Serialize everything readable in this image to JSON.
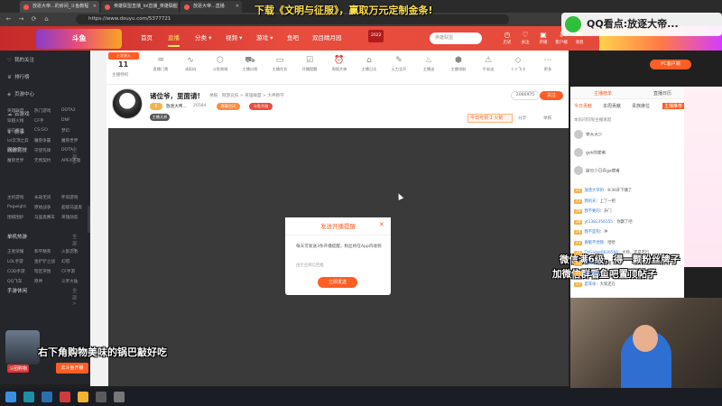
{
  "browser": {
    "tabs": [
      {
        "label": "放逐大帝...的房间_斗鱼教程"
      },
      {
        "label": "英雄联盟直播_lol直播_英雄联盟"
      },
      {
        "label": "放逐大帝...直播"
      }
    ],
    "url": "https://www.douyu.com/5377721"
  },
  "overlay": {
    "top_caption": "下载《文明与征服》，赢取万元定制金条!",
    "qq_caption": "QQ看点:放逐大帝...",
    "fans_line1": "微信满6级，得一颗粉丝牌子",
    "fans_line2": "加微信群看鱼吧置顶帖子",
    "bottom_caption": "右下角购物美味的锅巴敲好吃"
  },
  "header": {
    "logo": "斗鱼",
    "nav": [
      "首页",
      "直播",
      "分类 ▾",
      "视频 ▾",
      "游戏 ▾",
      "鱼吧",
      "双目睛月园"
    ],
    "badge_2022": "2022",
    "search_placeholder": "英雄联盟",
    "icons": [
      "历史",
      "关注",
      "开播",
      "客户端",
      "消息",
      "领任务",
      "我的"
    ]
  },
  "sidebar": {
    "items": [
      "我的关注",
      "排行榜",
      "页游中心",
      "云游戏",
      "赛事"
    ],
    "groups": [
      {
        "title": "网游竞技",
        "more": "全部 >",
        "cells": [
          "英雄联盟",
          "热门游戏",
          "DOTA2",
          "穿越火线",
          "CF手",
          "DNF",
          "炉石传说",
          "CS:GO",
          "梦幻",
          "lol云顶之弈",
          "魔兽争霸",
          "魔兽世界",
          "冒险岛",
          "守望先锋",
          "DOTA",
          "魔兽世界",
          "无畏契约",
          "APEX英雄"
        ]
      },
      {
        "title": "单机热游",
        "more": "全部 >",
        "cells": [
          "主机游戏",
          "永劫无间",
          "怀旧游戏",
          "Pogwight",
          "原始战争",
          "超级马里奥",
          "围棋围炉",
          "马里奥赛车",
          "英雄动态"
        ]
      },
      {
        "title": "手游休闲",
        "more": "全部 >",
        "cells": [
          "王者荣耀",
          "和平精英",
          "火影忍者",
          "LOL手游",
          "金铲铲之战",
          "幻塔",
          "COD手游",
          "暗区突围",
          "CF手游",
          "QQ飞车",
          "原神",
          "斗罗大陆"
        ]
      }
    ],
    "shop_label": "斗团购物",
    "shop_button": "去斗鱼开播"
  },
  "toolbar": {
    "last_visit": "上次进入",
    "count": "11",
    "count_label": "主播特权",
    "tools": [
      "直播门票",
      "派彩码",
      "斗鱼商城",
      "主播口袋",
      "主播任务",
      "开播提醒",
      "周周大神",
      "主播日志",
      "火力全开",
      "主播送",
      "主播领取",
      "平安送",
      "卜卜飞卡",
      "更多"
    ],
    "pc_button": "PC客户端"
  },
  "room": {
    "title": "诸位爷，里面请!",
    "report": "举报",
    "category": "网游竞技 > 英雄联盟 > 大神教学",
    "host_name": "放逐大帝...",
    "fans": "20584",
    "tags": [
      "赛事空间",
      "主播天邦",
      "斗鱼大咖"
    ],
    "anchor_level": "6",
    "follower_count": "2066975",
    "follow_label": "关注",
    "rank_label": "今日可领",
    "rank_num": "1",
    "rank_unit": "火箭",
    "share": "分享",
    "report2": "举报"
  },
  "dialog": {
    "title": "发送开播提醒",
    "text": "每天可发送3条开播提醒，粉丝将在App内收到",
    "sub": "由企业微信回推",
    "button": "立即发送"
  },
  "right_panel": {
    "tabs": [
      "主播榜单",
      "直播日历"
    ],
    "sub_tabs": [
      "今日贡献",
      "本周贡献",
      "贵族席位",
      "主播推荐"
    ],
    "notice": "本房间仅限主播发起",
    "ranks": [
      "李大大少",
      "gok的使者",
      "敲分少已兵ga使者"
    ],
    "messages": [
      {
        "level": "21",
        "name": "放逐大帝的",
        "text": "8:30开下播了"
      },
      {
        "level": "13",
        "name": "我的天",
        "text": "上了一把"
      },
      {
        "level": "28",
        "name": "我不要的",
        "text": "开门"
      },
      {
        "level": "18",
        "name": "yt1382356155",
        "text": "你飘了吧"
      },
      {
        "level": "24",
        "name": "我不是狗",
        "text": "冲"
      },
      {
        "level": "21",
        "name": "春眠不觉晓",
        "text": "哈哈"
      },
      {
        "level": "19",
        "name": "TXGame6626566",
        "text": "大师，还是不行"
      },
      {
        "level": "12",
        "name": "风清云淡",
        "text": "下播了"
      },
      {
        "level": "23",
        "name": "爱上游戏",
        "text": "来了"
      },
      {
        "level": "17",
        "name": "是耳朵",
        "text": "大家还在"
      }
    ]
  },
  "colors": {
    "brand_orange": "#ff5d23",
    "header_red": "#e34a3a"
  }
}
